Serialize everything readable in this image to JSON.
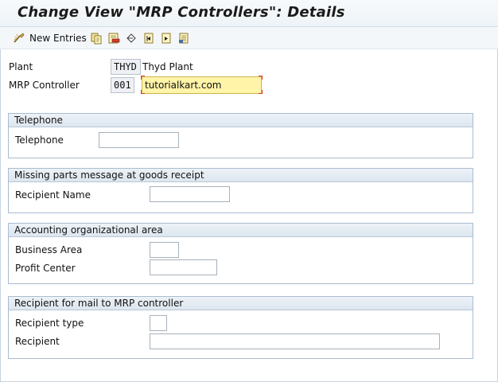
{
  "header": {
    "title": "Change View \"MRP Controllers\": Details"
  },
  "toolbar": {
    "new_entries_label": "New Entries",
    "icons": [
      "glasses-icon",
      "copy-icon",
      "delete-icon",
      "undo-icon",
      "first-entry-icon",
      "next-entry-icon",
      "last-entry-icon"
    ]
  },
  "fields": {
    "plant": {
      "label": "Plant",
      "value": "THYD",
      "description": "Thyd Plant"
    },
    "mrp_controller": {
      "label": "MRP Controller",
      "value": "001",
      "description": "tutorialkart.com"
    }
  },
  "groups": {
    "telephone": {
      "title": "Telephone",
      "telephone_label": "Telephone",
      "telephone_value": ""
    },
    "missing_parts": {
      "title": "Missing parts message at goods receipt",
      "recipient_name_label": "Recipient Name",
      "recipient_name_value": ""
    },
    "accounting": {
      "title": "Accounting organizational area",
      "business_area_label": "Business Area",
      "business_area_value": "",
      "profit_center_label": "Profit Center",
      "profit_center_value": ""
    },
    "mail": {
      "title": "Recipient for mail to MRP controller",
      "recipient_type_label": "Recipient type",
      "recipient_type_value": "",
      "recipient_label": "Recipient",
      "recipient_value": ""
    }
  },
  "colors": {
    "highlight": "#fff4a8",
    "group_border": "#a9bccf",
    "required_mark": "#e0322a"
  }
}
